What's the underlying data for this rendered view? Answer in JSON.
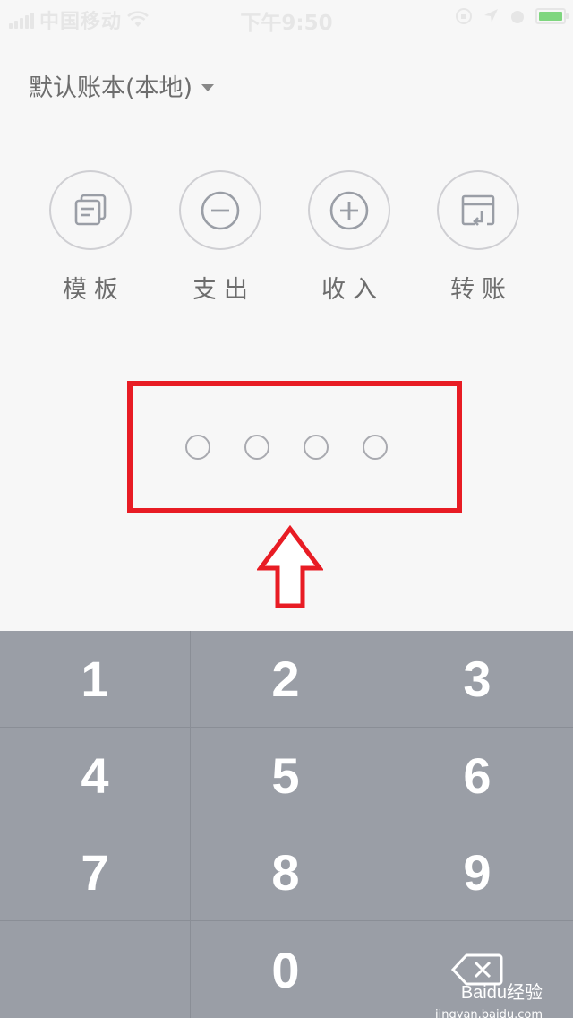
{
  "status_bar": {
    "carrier": "中国移动",
    "time": "下午9:50"
  },
  "header": {
    "book_name": "默认账本(本地)"
  },
  "actions": [
    {
      "label": "模板",
      "icon": "template-icon"
    },
    {
      "label": "支出",
      "icon": "minus-circle-icon"
    },
    {
      "label": "收入",
      "icon": "plus-circle-icon"
    },
    {
      "label": "转账",
      "icon": "transfer-icon"
    }
  ],
  "pin": {
    "length": 4,
    "entered": 0
  },
  "keypad": {
    "keys": [
      "1",
      "2",
      "3",
      "4",
      "5",
      "6",
      "7",
      "8",
      "9",
      "",
      "0",
      ""
    ]
  },
  "watermark": {
    "brand": "Baidu经验",
    "url": "jingyan.baidu.com"
  },
  "colors": {
    "annotation_red": "#e81c24",
    "keypad_bg": "#9a9ea6",
    "page_bg": "#f7f7f7"
  }
}
